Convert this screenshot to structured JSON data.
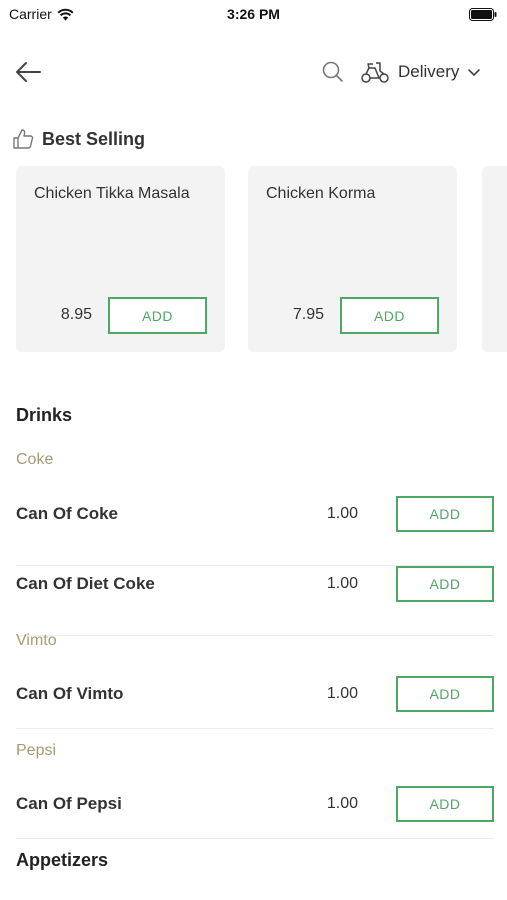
{
  "status_bar": {
    "carrier": "Carrier",
    "time": "3:26 PM"
  },
  "nav": {
    "delivery_label": "Delivery"
  },
  "best_selling": {
    "title": "Best Selling",
    "items": [
      {
        "name": "Chicken Tikka Masala",
        "price": "8.95",
        "add_label": "ADD"
      },
      {
        "name": "Chicken Korma",
        "price": "7.95",
        "add_label": "ADD"
      }
    ]
  },
  "sections": [
    {
      "title": "Drinks",
      "groups": [
        {
          "name": "Coke",
          "items": [
            {
              "name": "Can Of Coke",
              "price": "1.00",
              "add_label": "ADD"
            },
            {
              "name": "Can Of Diet Coke",
              "price": "1.00",
              "add_label": "ADD"
            }
          ]
        },
        {
          "name": "Vimto",
          "items": [
            {
              "name": "Can Of Vimto",
              "price": "1.00",
              "add_label": "ADD"
            }
          ]
        },
        {
          "name": "Pepsi",
          "items": [
            {
              "name": "Can Of Pepsi",
              "price": "1.00",
              "add_label": "ADD"
            }
          ]
        }
      ]
    },
    {
      "title": "Appetizers"
    }
  ],
  "colors": {
    "accent_green": "#4fa764",
    "subcategory_gold": "#a69a72",
    "card_bg": "#f3f3f3"
  }
}
